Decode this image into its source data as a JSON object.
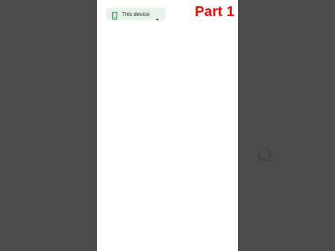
{
  "device_selector": {
    "label": "This device",
    "icon": "smartphone-icon",
    "dropdown_icon": "caret-down-icon",
    "background": "#e6f4ea",
    "icon_color": "#188038"
  },
  "overlay": {
    "part_label": "Part 1",
    "color": "#e00000"
  },
  "loading": {
    "icon": "loading-spinner-icon",
    "color": "#3c4043"
  },
  "colors": {
    "side_background": "#4b4b4b",
    "screen_background": "#ffffff"
  }
}
